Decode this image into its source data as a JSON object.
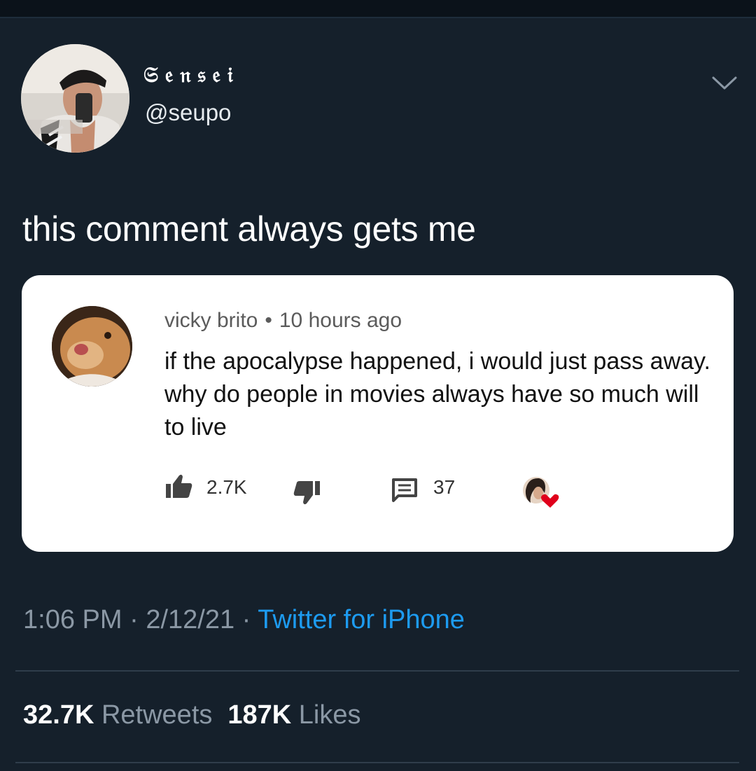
{
  "tweet": {
    "author": {
      "display_name": "𝔖𝔢𝔫𝔰𝔢𝔦",
      "handle": "@seupo"
    },
    "text": "this comment always gets me",
    "timestamp_time": "1:06 PM",
    "timestamp_date": "2/12/21",
    "separator": "·",
    "source": "Twitter for iPhone",
    "stats": {
      "retweets_count": "32.7K",
      "retweets_label": "Retweets",
      "likes_count": "187K",
      "likes_label": "Likes"
    }
  },
  "comment": {
    "author": "vicky brito",
    "separator": "•",
    "time_ago": "10 hours ago",
    "text": "if the apocalypse happened, i would just pass away. why do people in movies always have so much will to live",
    "likes": "2.7K",
    "replies": "37"
  },
  "icons": {
    "menu": "chevron-down-icon",
    "like": "thumbs-up-icon",
    "dislike": "thumbs-down-icon",
    "reply": "comment-icon",
    "creator_heart": "creator-heart-icon"
  },
  "colors": {
    "background": "#15202b",
    "link": "#1d9bf0",
    "muted": "#8b98a5",
    "card": "#ffffff",
    "heart": "#e0001b"
  }
}
